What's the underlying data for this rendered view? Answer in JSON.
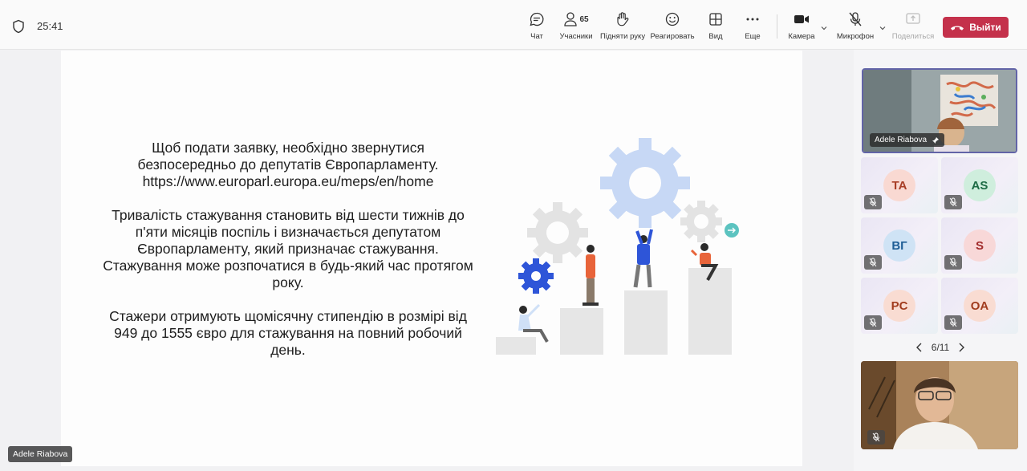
{
  "header": {
    "timer": "25:41",
    "participants_count": "65",
    "buttons": {
      "chat": "Чат",
      "participants": "Учасники",
      "raise_hand": "Підняти руку",
      "react": "Реагировать",
      "view": "Вид",
      "more": "Еще",
      "camera": "Камера",
      "mic": "Микрофон",
      "share": "Поделиться",
      "leave": "Выйти"
    }
  },
  "slide": {
    "paragraphs": [
      "Щоб подати заявку, необхідно звернутися безпосередньо до депутатів Європарламенту. https://www.europarl.europa.eu/meps/en/home",
      "Тривалість стажування становить від шести тижнів до п'яти місяців поспіль і визначається депутатом Європарламенту, який призначає стажування. Стажування може розпочатися в будь-який час протягом року.",
      "Стажери отримують щомісячну стипендію в розмірі від 949 до 1555 євро для стажування на повний робочий день."
    ]
  },
  "presenter_name": "Adele Riabova",
  "spotlight": {
    "name": "Adele Riabova"
  },
  "participants": [
    {
      "initials": "TA",
      "bg": "#f9d9d2",
      "fg": "#a83e27"
    },
    {
      "initials": "AS",
      "bg": "#cfeedd",
      "fg": "#1d6b45"
    },
    {
      "initials": "ВГ",
      "bg": "#cfe3f5",
      "fg": "#1f5e96"
    },
    {
      "initials": "S",
      "bg": "#f8d8d8",
      "fg": "#a12c2c"
    },
    {
      "initials": "PC",
      "bg": "#f9dcd2",
      "fg": "#a13c1e"
    },
    {
      "initials": "OA",
      "bg": "#f9dcd2",
      "fg": "#a13c1e"
    }
  ],
  "pagination": "6/11",
  "colors": {
    "accent": "#6264a7",
    "leave": "#c4314b"
  }
}
